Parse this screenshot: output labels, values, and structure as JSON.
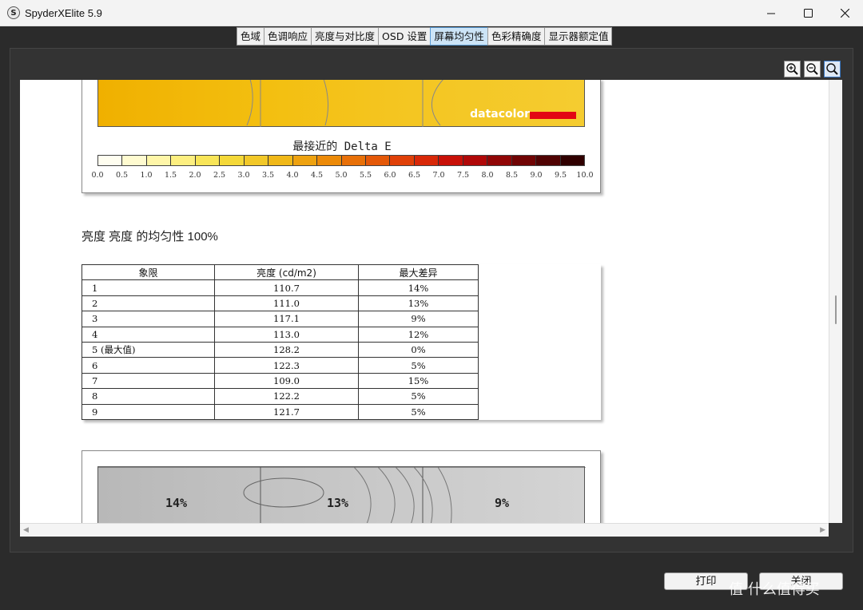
{
  "window": {
    "title": "SpyderXElite 5.9",
    "icon": "S"
  },
  "tabs": [
    {
      "label": "色域"
    },
    {
      "label": "色调响应"
    },
    {
      "label": "亮度与对比度"
    },
    {
      "label": "OSD 设置"
    },
    {
      "label": "屏幕均匀性",
      "active": true
    },
    {
      "label": "色彩精确度"
    },
    {
      "label": "显示器额定值"
    }
  ],
  "brand": {
    "logo_text": "datacolor",
    "logo_color": "#e30613"
  },
  "legend": {
    "title": "最接近的 Delta E",
    "labels": [
      "0.0",
      "0.5",
      "1.0",
      "1.5",
      "2.0",
      "2.5",
      "3.0",
      "3.5",
      "4.0",
      "4.5",
      "5.0",
      "5.5",
      "6.0",
      "6.5",
      "7.0",
      "7.5",
      "8.0",
      "8.5",
      "9.0",
      "9.5",
      "10.0"
    ],
    "colors": [
      "#fffef0",
      "#fffbd0",
      "#fff6a8",
      "#fdef80",
      "#f8e558",
      "#f4d838",
      "#f2c828",
      "#f0b818",
      "#eea210",
      "#ec8a08",
      "#e87008",
      "#e45808",
      "#e04008",
      "#d82808",
      "#c81008",
      "#b00808",
      "#900606",
      "#700404",
      "#500202",
      "#300000"
    ]
  },
  "section": {
    "heading": "亮度 亮度 的均匀性 100%"
  },
  "table": {
    "headers": [
      "象限",
      "亮度 (cd/m2)",
      "最大差异"
    ],
    "rows": [
      [
        "1",
        "110.7",
        "14%"
      ],
      [
        "2",
        "111.0",
        "13%"
      ],
      [
        "3",
        "117.1",
        "9%"
      ],
      [
        "4",
        "113.0",
        "12%"
      ],
      [
        "5 (最大值)",
        "128.2",
        "0%"
      ],
      [
        "6",
        "122.3",
        "5%"
      ],
      [
        "7",
        "109.0",
        "15%"
      ],
      [
        "8",
        "122.2",
        "5%"
      ],
      [
        "9",
        "121.7",
        "5%"
      ]
    ]
  },
  "map": {
    "labels": [
      "14%",
      "13%",
      "9%"
    ]
  },
  "buttons": {
    "print": "打印",
    "close": "关闭"
  },
  "watermark": "值 什么值得买"
}
